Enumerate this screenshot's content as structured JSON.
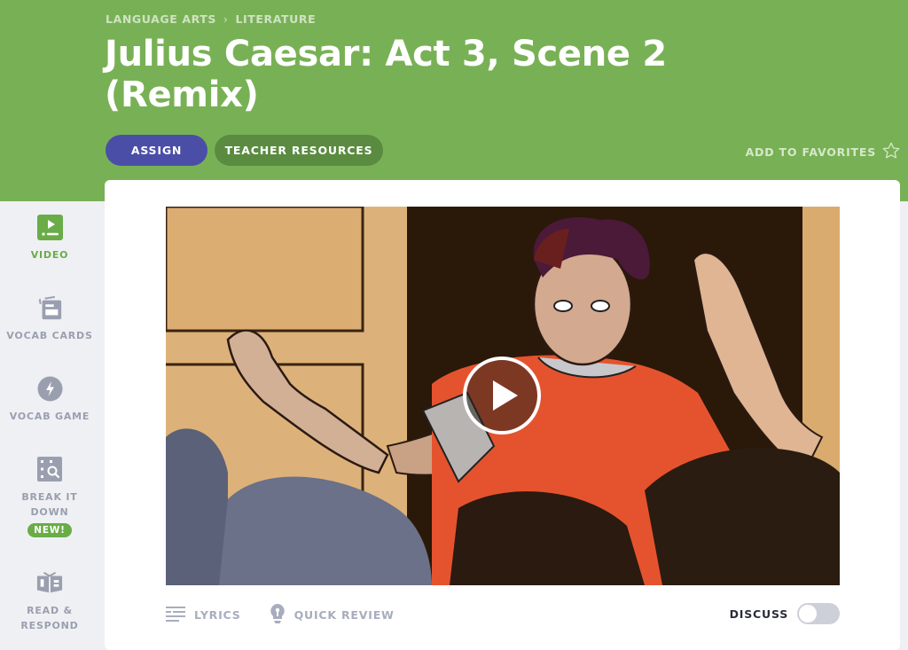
{
  "colors": {
    "header_bg": "#78b155",
    "assign_bg": "#4b4ea6",
    "resources_bg": "#5a8b40",
    "active_nav": "#6aac47",
    "inactive_nav": "#9a9fb0"
  },
  "header": {
    "breadcrumb": [
      "LANGUAGE ARTS",
      "LITERATURE"
    ],
    "breadcrumb_separator": "›",
    "title": "Julius Caesar: Act 3, Scene 2 (Remix)",
    "assign_label": "ASSIGN",
    "resources_label": "TEACHER RESOURCES",
    "favorites_label": "ADD TO FAVORITES",
    "favorites_icon": "star-outline-icon"
  },
  "sidebar": {
    "items": [
      {
        "label": "VIDEO",
        "icon": "video-icon",
        "active": true
      },
      {
        "label": "VOCAB CARDS",
        "icon": "vocab-cards-icon",
        "active": false
      },
      {
        "label": "VOCAB GAME",
        "icon": "lightning-icon",
        "active": false
      },
      {
        "label": "BREAK IT DOWN",
        "icon": "break-it-down-icon",
        "active": false,
        "badge": "NEW!"
      },
      {
        "label": "READ & RESPOND",
        "icon": "book-icon",
        "active": false
      }
    ]
  },
  "video": {
    "play_icon": "play-icon"
  },
  "tabs": {
    "lyrics_label": "LYRICS",
    "quick_review_label": "QUICK REVIEW",
    "discuss_label": "DISCUSS",
    "discuss_enabled": false
  }
}
